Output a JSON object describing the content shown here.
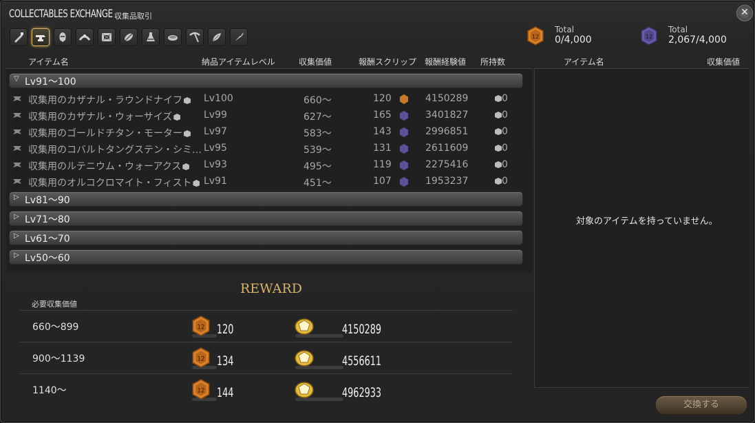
{
  "window": {
    "title": "COLLECTABLES EXCHANGE",
    "subtitle": "収集品取引",
    "close_icon": "close-icon"
  },
  "jobs": [
    "carpenter",
    "blacksmith",
    "armorer",
    "goldsmith",
    "leatherworker",
    "weaver",
    "alchemist",
    "culinarian",
    "miner",
    "botanist",
    "fisher"
  ],
  "totals": [
    {
      "label": "Total",
      "value": "0/4,000",
      "color": "#d9822b"
    },
    {
      "label": "Total",
      "value": "2,067/4,000",
      "color": "#6a5aa8"
    }
  ],
  "headers": {
    "item_name": "アイテム名",
    "item_level": "納品アイテムレベル",
    "collectability": "収集価値",
    "reward_scrip": "報酬スクリップ",
    "reward_exp": "報酬経験値",
    "owned": "所持数",
    "right_item_name": "アイテム名",
    "right_collectability": "収集価値"
  },
  "groups": [
    {
      "label": "Lv91～100",
      "expanded": true
    },
    {
      "label": "Lv81～90",
      "expanded": false
    },
    {
      "label": "Lv71～80",
      "expanded": false
    },
    {
      "label": "Lv61～70",
      "expanded": false
    },
    {
      "label": "Lv50～60",
      "expanded": false
    }
  ],
  "items": [
    {
      "name": "収集用のカザナル・ラウンドナイフ",
      "level": "Lv100",
      "collect": "660～",
      "scrip": "120",
      "scrip_type": "orange",
      "exp": "4150289",
      "owned": "0"
    },
    {
      "name": "収集用のカザナル・ウォーサイズ",
      "level": "Lv99",
      "collect": "627～",
      "scrip": "165",
      "scrip_type": "purple",
      "exp": "3401827",
      "owned": "0"
    },
    {
      "name": "収集用のゴールドチタン・モーター",
      "level": "Lv97",
      "collect": "583～",
      "scrip": "143",
      "scrip_type": "purple",
      "exp": "2996851",
      "owned": "0"
    },
    {
      "name": "収集用のコバルトタングステン・シミ…",
      "level": "Lv95",
      "collect": "539～",
      "scrip": "131",
      "scrip_type": "purple",
      "exp": "2611609",
      "owned": "0"
    },
    {
      "name": "収集用のルテニウム・ウォーアクス",
      "level": "Lv93",
      "collect": "495～",
      "scrip": "119",
      "scrip_type": "purple",
      "exp": "2275416",
      "owned": "0"
    },
    {
      "name": "収集用のオルコクロマイト・フィスト",
      "level": "Lv91",
      "collect": "451～",
      "scrip": "107",
      "scrip_type": "purple",
      "exp": "1953237",
      "owned": "0"
    }
  ],
  "reward": {
    "title": "REWARD",
    "required_label": "必要収集価値",
    "rows": [
      {
        "range": "660～899",
        "scrip": "120",
        "exp": "4150289"
      },
      {
        "range": "900～1139",
        "scrip": "134",
        "exp": "4556611"
      },
      {
        "range": "1140～",
        "scrip": "144",
        "exp": "4962933"
      }
    ]
  },
  "right_panel": {
    "empty_message": "対象のアイテムを持っていません。"
  },
  "exchange_button": "交換する"
}
